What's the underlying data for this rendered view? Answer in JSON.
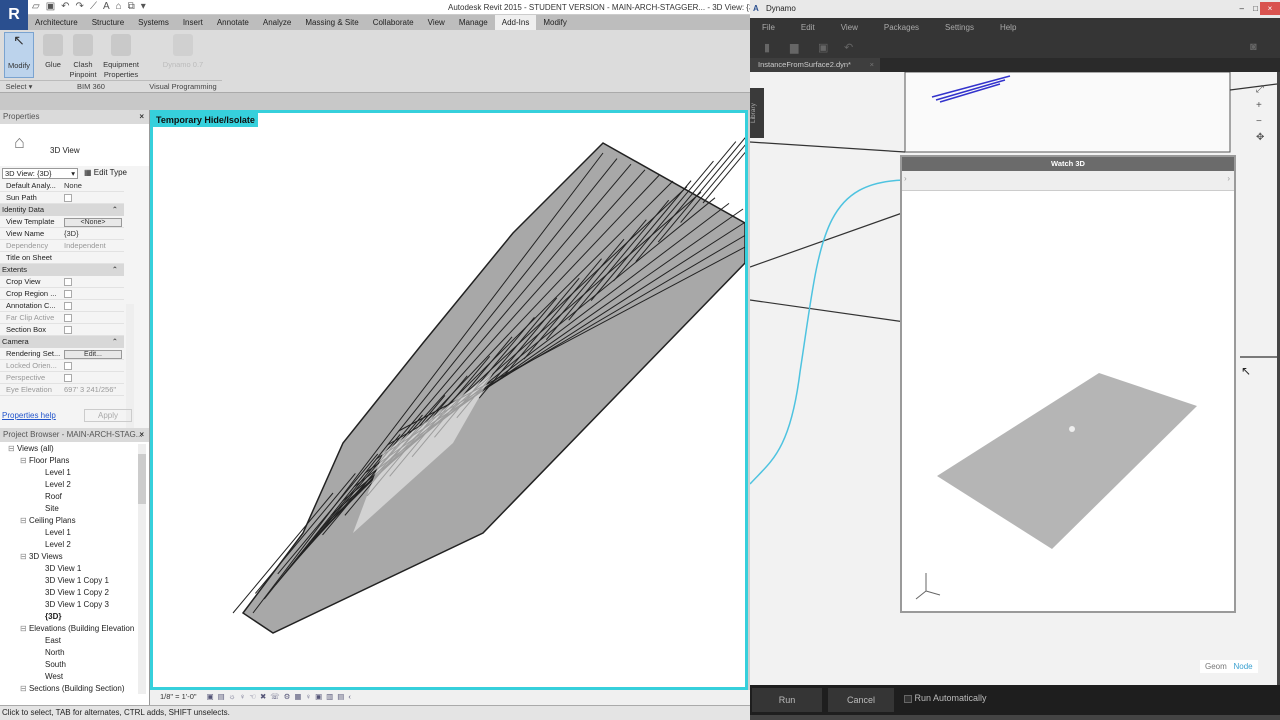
{
  "revit": {
    "window_title": "Autodesk Revit 2015 - STUDENT VERSION -    MAIN-ARCH-STAGGER... - 3D View: {3D}",
    "tabs": [
      "Architecture",
      "Structure",
      "Systems",
      "Insert",
      "Annotate",
      "Analyze",
      "Massing & Site",
      "Collaborate",
      "View",
      "Manage",
      "Add-Ins",
      "Modify"
    ],
    "active_tab": "Add-Ins",
    "ribbon": {
      "modify": "Modify",
      "glue": "Glue",
      "clash1": "Clash",
      "clash2": "Pinpoint",
      "equip1": "Equipment",
      "equip2": "Properties",
      "dynamo": "Dynamo 0.7",
      "group_select": "Select ▾",
      "group_bim": "BIM 360",
      "group_vp": "Visual Programming"
    },
    "properties": {
      "title": "Properties",
      "type_name": "3D View",
      "type_selector": "3D View: {3D}",
      "edit_type": "Edit Type",
      "rows": [
        {
          "k": "Default Analy...",
          "v": "None",
          "kind": "text"
        },
        {
          "k": "Sun Path",
          "v": "",
          "kind": "check"
        },
        {
          "section": "Identity Data"
        },
        {
          "k": "View Template",
          "v": "<None>",
          "kind": "button"
        },
        {
          "k": "View Name",
          "v": "{3D}",
          "kind": "text"
        },
        {
          "k": "Dependency",
          "v": "Independent",
          "kind": "text",
          "disabled": true
        },
        {
          "k": "Title on Sheet",
          "v": "",
          "kind": "text"
        },
        {
          "section": "Extents"
        },
        {
          "k": "Crop View",
          "v": "",
          "kind": "check"
        },
        {
          "k": "Crop Region ...",
          "v": "",
          "kind": "check"
        },
        {
          "k": "Annotation C...",
          "v": "",
          "kind": "check"
        },
        {
          "k": "Far Clip Active",
          "v": "",
          "kind": "check",
          "disabled": true
        },
        {
          "k": "Section Box",
          "v": "",
          "kind": "check"
        },
        {
          "section": "Camera"
        },
        {
          "k": "Rendering Set...",
          "v": "Edit...",
          "kind": "button"
        },
        {
          "k": "Locked Orien...",
          "v": "",
          "kind": "check",
          "disabled": true
        },
        {
          "k": "Perspective",
          "v": "",
          "kind": "check",
          "disabled": true
        },
        {
          "k": "Eye Elevation",
          "v": "697'  3 241/256\"",
          "kind": "text",
          "disabled": true
        }
      ],
      "help": "Properties help",
      "apply": "Apply"
    },
    "browser": {
      "title": "Project Browser - MAIN-ARCH-STAG...",
      "nodes": [
        {
          "t": "Views (all)",
          "d": 0
        },
        {
          "t": "Floor Plans",
          "d": 1
        },
        {
          "t": "Level 1",
          "d": 2
        },
        {
          "t": "Level 2",
          "d": 2
        },
        {
          "t": "Roof",
          "d": 2
        },
        {
          "t": "Site",
          "d": 2
        },
        {
          "t": "Ceiling Plans",
          "d": 1
        },
        {
          "t": "Level 1",
          "d": 2
        },
        {
          "t": "Level 2",
          "d": 2
        },
        {
          "t": "3D Views",
          "d": 1
        },
        {
          "t": "3D View 1",
          "d": 2
        },
        {
          "t": "3D View 1 Copy 1",
          "d": 2
        },
        {
          "t": "3D View 1 Copy 2",
          "d": 2
        },
        {
          "t": "3D View 1 Copy 3",
          "d": 2
        },
        {
          "t": "{3D}",
          "d": 2,
          "bold": true
        },
        {
          "t": "Elevations (Building Elevation",
          "d": 1
        },
        {
          "t": "East",
          "d": 2
        },
        {
          "t": "North",
          "d": 2
        },
        {
          "t": "South",
          "d": 2
        },
        {
          "t": "West",
          "d": 2
        },
        {
          "t": "Sections (Building Section)",
          "d": 1
        }
      ]
    },
    "view_label": "Temporary Hide/Isolate",
    "scale": "1/8\" = 1'-0\"",
    "status": "Click to select, TAB for alternates, CTRL adds, SHIFT unselects.",
    "accent": "#36d0dc"
  },
  "dynamo": {
    "title": "Dynamo",
    "menu": [
      "File",
      "Edit",
      "View",
      "Packages",
      "Settings",
      "Help"
    ],
    "file_tab": "InstanceFromSurface2.dyn*",
    "library": "Library",
    "watch_title": "Watch 3D",
    "geom": "Geom",
    "node": "Node",
    "run": "Run",
    "cancel": "Cancel",
    "run_auto": "Run Automatically",
    "wire_color": "#4ec3e0"
  }
}
